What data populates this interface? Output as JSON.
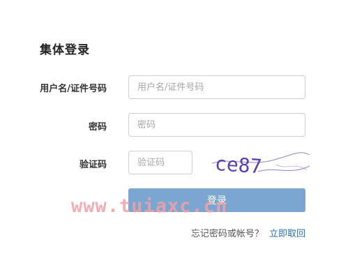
{
  "form": {
    "title": "集体登录",
    "username": {
      "label": "用户名/证件号码",
      "placeholder": "用户名/证件号码",
      "value": ""
    },
    "password": {
      "label": "密码",
      "placeholder": "密码",
      "value": ""
    },
    "captcha": {
      "label": "验证码",
      "placeholder": "验证码",
      "value": "",
      "image_text": "ce87"
    },
    "login_button": "登录",
    "forgot_text": "忘记密码或帐号？",
    "forgot_link": "立即取回"
  },
  "watermark": "www.tuiaxc.cn",
  "colors": {
    "button_bg": "#7aa6d1",
    "link": "#2f6fb0",
    "captcha_ink": "#5b3fb0",
    "watermark": "#f2a0a6"
  }
}
